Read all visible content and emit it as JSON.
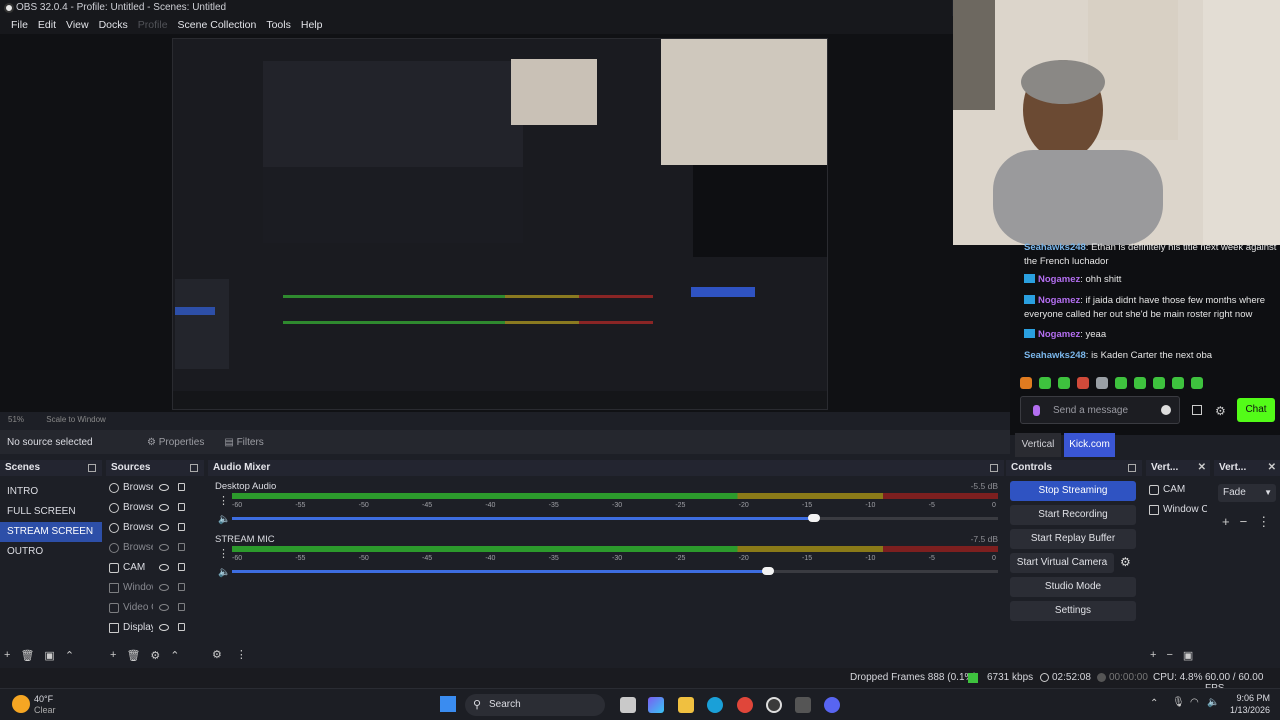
{
  "window": {
    "title": "OBS 32.0.4 - Profile: Untitled - Scenes: Untitled"
  },
  "menu": [
    "File",
    "Edit",
    "View",
    "Docks",
    "Profile",
    "Scene Collection",
    "Tools",
    "Help"
  ],
  "preview": {
    "zoom": "51%",
    "scale_mode": "Scale to Window"
  },
  "source_bar": {
    "no_source": "No source selected",
    "properties": "Properties",
    "filters": "Filters"
  },
  "chat": {
    "messages": [
      {
        "user": "Seahawks248",
        "text": ": Ethan is definitely his title next week against the French luchador"
      },
      {
        "user": "Nogamez",
        "text": ": ohh shitt"
      },
      {
        "user": "Nogamez",
        "text": ": if jaida didnt have those few months where everyone called her out she'd be main roster right now"
      },
      {
        "user": "Nogamez",
        "text": ": yeaa"
      },
      {
        "user": "Seahawks248",
        "text": ": is Kaden Carter the next oba"
      }
    ],
    "input_placeholder": "Send a message",
    "chat_button": "Chat",
    "tabs": [
      "Vertical",
      "Kick.com"
    ]
  },
  "docks": {
    "scenes": {
      "title": "Scenes",
      "items": [
        "INTRO",
        "FULL SCREEN",
        "STREAM SCREEN",
        "OUTRO"
      ],
      "selected": "STREAM SCREEN"
    },
    "sources": {
      "title": "Sources",
      "items": [
        "Browser",
        "Browser",
        "Browser",
        "Browser",
        "CAM",
        "Window Capture",
        "Video Capture",
        "Display"
      ]
    },
    "mixer": {
      "title": "Audio Mixer",
      "tracks": [
        {
          "name": "Desktop Audio",
          "db": "-5.5 dB",
          "level": 0.76
        },
        {
          "name": "STREAM MIC",
          "db": "-7.5 dB",
          "level": 0.7
        }
      ],
      "ticks": [
        "-60",
        "-55",
        "-50",
        "-45",
        "-40",
        "-35",
        "-30",
        "-25",
        "-20",
        "-15",
        "-10",
        "-5",
        "0"
      ]
    },
    "controls": {
      "title": "Controls",
      "buttons": [
        "Stop Streaming",
        "Start Recording",
        "Start Replay Buffer",
        "Start Virtual Camera",
        "Studio Mode",
        "Settings"
      ]
    },
    "vertical_sources": {
      "title": "Vert...",
      "items": [
        "CAM",
        "Window C..."
      ]
    },
    "vertical_transition": {
      "title": "Vert...",
      "value": "Fade"
    }
  },
  "status": {
    "dropped": "Dropped Frames 888 (0.1%)",
    "bitrate": "6731 kbps",
    "live_time": "02:52:08",
    "rec_time": "00:00:00",
    "cpu": "CPU: 4.8%",
    "fps": "60.00 / 60.00 FPS"
  },
  "taskbar": {
    "temp": "40°F",
    "weather": "Clear",
    "search": "Search",
    "time": "9:06 PM",
    "date": "1/13/2026"
  },
  "colors": {
    "accent": "#2f53c2",
    "kick_green": "#53fc18",
    "chat_user1": "#7ab6ea",
    "chat_user2": "#b36ef0"
  }
}
